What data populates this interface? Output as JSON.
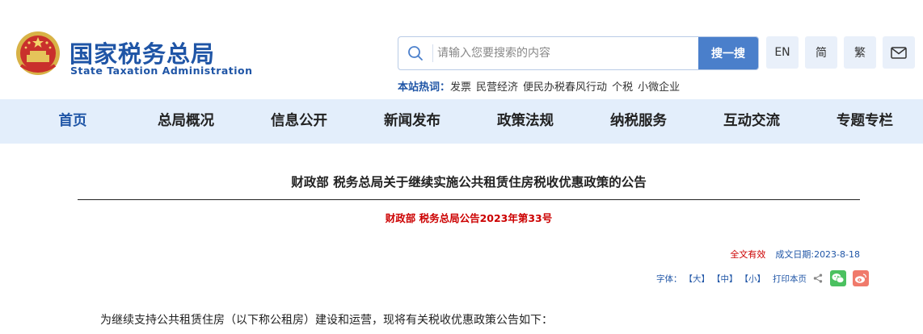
{
  "header": {
    "logo_cn": "国家税务总局",
    "logo_en": "State Taxation Administration",
    "emblem_icon": "national-emblem-icon"
  },
  "search": {
    "placeholder": "请输入您要搜索的内容",
    "value": "",
    "button_label": "搜一搜"
  },
  "lang": {
    "en": "EN",
    "simplified": "简",
    "traditional": "繁",
    "mail_icon": "mail-icon"
  },
  "hotwords": {
    "label": "本站热词：",
    "items": [
      "发票",
      "民营经济",
      "便民办税春风行动",
      "个税",
      "小微企业"
    ]
  },
  "nav": {
    "items": [
      "首页",
      "总局概况",
      "信息公开",
      "新闻发布",
      "政策法规",
      "纳税服务",
      "互动交流",
      "专题专栏"
    ],
    "active_index": 0
  },
  "article": {
    "title": "财政部 税务总局关于继续实施公共租赁住房税收优惠政策的公告",
    "doc_number": "财政部  税务总局公告2023年第33号",
    "validity": "全文有效",
    "date": "成文日期:2023-8-18",
    "font_label": "字体：",
    "font_large": "【大】",
    "font_medium": "【中】",
    "font_small": "【小】",
    "print": "打印本页",
    "intro": "为继续支持公共租赁住房（以下称公租房）建设和运营，现将有关税收优惠政策公告如下："
  },
  "colors": {
    "brand_blue": "#1f55a6",
    "nav_bg": "#e3eefb",
    "search_button": "#4a7fcb",
    "accent_red": "#cc0000"
  }
}
